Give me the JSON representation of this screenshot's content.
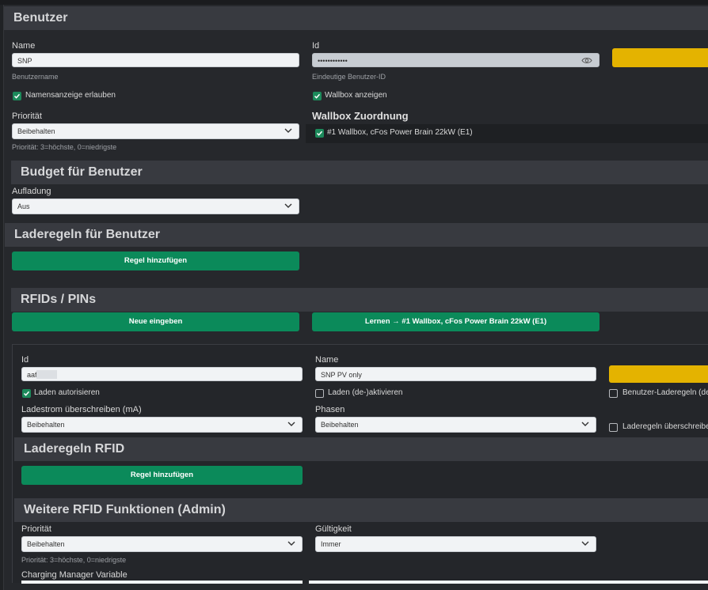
{
  "benutzer": {
    "section_title": "Benutzer",
    "name_label": "Name",
    "name_value": "SNP",
    "name_hint": "Benutzername",
    "id_label": "Id",
    "id_value": "••••••••••••",
    "id_hint": "Eindeutige Benutzer-ID",
    "namensanzeige_label": "Namensanzeige erlauben",
    "wallbox_anzeigen_label": "Wallbox anzeigen",
    "prioritaet_label": "Priorität",
    "prioritaet_value": "Beibehalten",
    "prioritaet_hint": "Priorität: 3=höchste, 0=niedrigste",
    "wallbox_zuordnung_title": "Wallbox Zuordnung",
    "wallbox_item": "#1 Wallbox, cFos Power Brain 22kW (E1)"
  },
  "budget": {
    "section_title": "Budget für Benutzer",
    "aufladung_label": "Aufladung",
    "aufladung_value": "Aus"
  },
  "laderegeln": {
    "section_title": "Laderegeln für Benutzer",
    "add_rule_button": "Regel hinzufügen"
  },
  "rfids": {
    "section_title": "RFIDs / PINs",
    "neue_button": "Neue eingeben",
    "lernen_button": "Lernen → #1 Wallbox, cFos Power Brain 22kW (E1)",
    "card": {
      "id_label": "Id",
      "id_value": "aaf",
      "name_label": "Name",
      "name_value": "SNP PV only",
      "laden_autorisieren": "Laden autorisieren",
      "laden_deaktivieren": "Laden (de-)aktivieren",
      "benutzer_laderegeln": "Benutzer-Laderegeln (de",
      "ladestrom_label": "Ladestrom überschreiben (mA)",
      "ladestrom_value": "Beibehalten",
      "phasen_label": "Phasen",
      "phasen_value": "Beibehalten",
      "laderegeln_ueberschreiben": "Laderegeln überschreibe",
      "laderegeln_rfid_title": "Laderegeln RFID",
      "add_rule_button": "Regel hinzufügen",
      "weitere_title": "Weitere RFID Funktionen (Admin)",
      "prioritaet_label": "Priorität",
      "prioritaet_value": "Beibehalten",
      "prioritaet_hint": "Priorität: 3=höchste, 0=niedrigste",
      "gueltigkeit_label": "Gültigkeit",
      "gueltigkeit_value": "Immer",
      "cm_variable_label": "Charging Manager Variable"
    }
  },
  "colors": {
    "green": "#0b8a5a",
    "yellow": "#e4b300",
    "header_bg": "#383a40"
  }
}
